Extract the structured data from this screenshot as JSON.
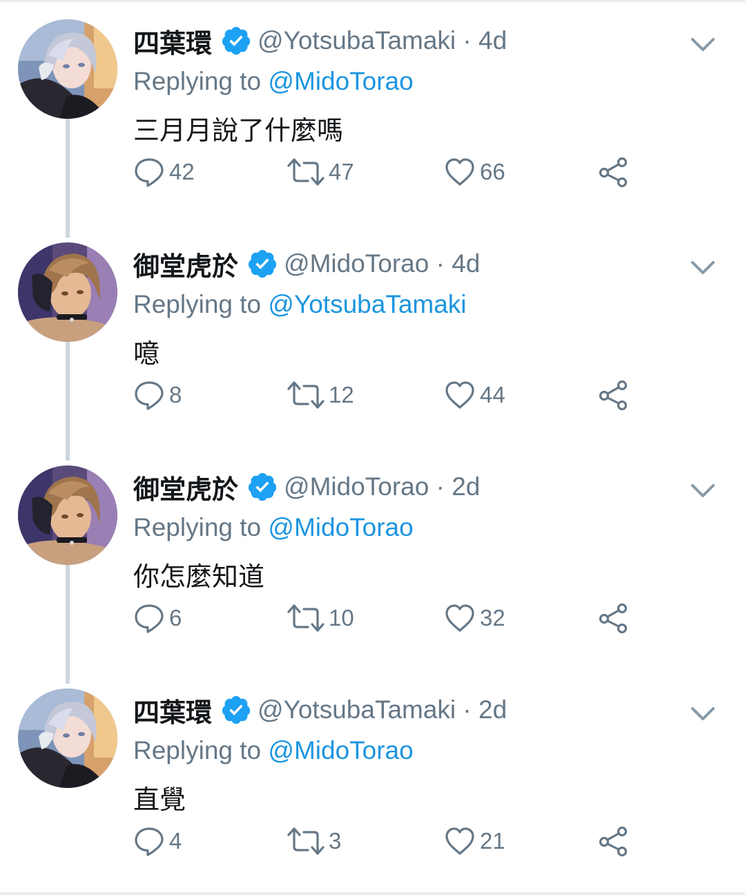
{
  "tweets": [
    {
      "name": "四葉環",
      "handle": "@YotsubaTamaki · 4d",
      "replying_prefix": "Replying to",
      "replying_to": "@MidoTorao",
      "text": "三月月說了什麼嗎",
      "replies": "42",
      "retweets": "47",
      "likes": "66",
      "avatar": "tamaki"
    },
    {
      "name": "御堂虎於",
      "handle": "@MidoTorao · 4d",
      "replying_prefix": "Replying to",
      "replying_to": "@YotsubaTamaki",
      "text": "噫",
      "replies": "8",
      "retweets": "12",
      "likes": "44",
      "avatar": "torao"
    },
    {
      "name": "御堂虎於",
      "handle": "@MidoTorao · 2d",
      "replying_prefix": "Replying to",
      "replying_to": "@MidoTorao",
      "text": "你怎麼知道",
      "replies": "6",
      "retweets": "10",
      "likes": "32",
      "avatar": "torao"
    },
    {
      "name": "四葉環",
      "handle": "@YotsubaTamaki · 2d",
      "replying_prefix": "Replying to",
      "replying_to": "@MidoTorao",
      "text": "直覺",
      "replies": "4",
      "retweets": "3",
      "likes": "21",
      "avatar": "tamaki"
    }
  ],
  "icons": {
    "verified": "verified-badge-icon",
    "more": "chevron-down-icon",
    "reply": "reply-bubble-icon",
    "retweet": "retweet-icon",
    "like": "heart-icon",
    "share": "share-icon"
  },
  "colors": {
    "link": "#1b95e0",
    "verified": "#1da1f2",
    "secondary_text": "#657786",
    "primary_text": "#14171a",
    "thread_line": "#ccd6dd"
  }
}
